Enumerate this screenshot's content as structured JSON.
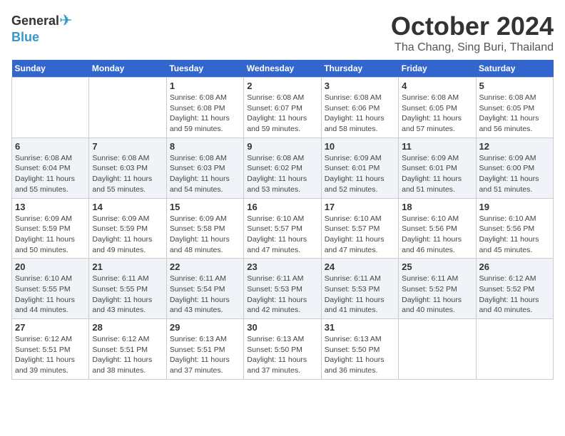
{
  "header": {
    "logo_general": "General",
    "logo_blue": "Blue",
    "month": "October 2024",
    "location": "Tha Chang, Sing Buri, Thailand"
  },
  "weekdays": [
    "Sunday",
    "Monday",
    "Tuesday",
    "Wednesday",
    "Thursday",
    "Friday",
    "Saturday"
  ],
  "weeks": [
    [
      {
        "day": "",
        "info": ""
      },
      {
        "day": "",
        "info": ""
      },
      {
        "day": "1",
        "info": "Sunrise: 6:08 AM\nSunset: 6:08 PM\nDaylight: 11 hours\nand 59 minutes."
      },
      {
        "day": "2",
        "info": "Sunrise: 6:08 AM\nSunset: 6:07 PM\nDaylight: 11 hours\nand 59 minutes."
      },
      {
        "day": "3",
        "info": "Sunrise: 6:08 AM\nSunset: 6:06 PM\nDaylight: 11 hours\nand 58 minutes."
      },
      {
        "day": "4",
        "info": "Sunrise: 6:08 AM\nSunset: 6:05 PM\nDaylight: 11 hours\nand 57 minutes."
      },
      {
        "day": "5",
        "info": "Sunrise: 6:08 AM\nSunset: 6:05 PM\nDaylight: 11 hours\nand 56 minutes."
      }
    ],
    [
      {
        "day": "6",
        "info": "Sunrise: 6:08 AM\nSunset: 6:04 PM\nDaylight: 11 hours\nand 55 minutes."
      },
      {
        "day": "7",
        "info": "Sunrise: 6:08 AM\nSunset: 6:03 PM\nDaylight: 11 hours\nand 55 minutes."
      },
      {
        "day": "8",
        "info": "Sunrise: 6:08 AM\nSunset: 6:03 PM\nDaylight: 11 hours\nand 54 minutes."
      },
      {
        "day": "9",
        "info": "Sunrise: 6:08 AM\nSunset: 6:02 PM\nDaylight: 11 hours\nand 53 minutes."
      },
      {
        "day": "10",
        "info": "Sunrise: 6:09 AM\nSunset: 6:01 PM\nDaylight: 11 hours\nand 52 minutes."
      },
      {
        "day": "11",
        "info": "Sunrise: 6:09 AM\nSunset: 6:01 PM\nDaylight: 11 hours\nand 51 minutes."
      },
      {
        "day": "12",
        "info": "Sunrise: 6:09 AM\nSunset: 6:00 PM\nDaylight: 11 hours\nand 51 minutes."
      }
    ],
    [
      {
        "day": "13",
        "info": "Sunrise: 6:09 AM\nSunset: 5:59 PM\nDaylight: 11 hours\nand 50 minutes."
      },
      {
        "day": "14",
        "info": "Sunrise: 6:09 AM\nSunset: 5:59 PM\nDaylight: 11 hours\nand 49 minutes."
      },
      {
        "day": "15",
        "info": "Sunrise: 6:09 AM\nSunset: 5:58 PM\nDaylight: 11 hours\nand 48 minutes."
      },
      {
        "day": "16",
        "info": "Sunrise: 6:10 AM\nSunset: 5:57 PM\nDaylight: 11 hours\nand 47 minutes."
      },
      {
        "day": "17",
        "info": "Sunrise: 6:10 AM\nSunset: 5:57 PM\nDaylight: 11 hours\nand 47 minutes."
      },
      {
        "day": "18",
        "info": "Sunrise: 6:10 AM\nSunset: 5:56 PM\nDaylight: 11 hours\nand 46 minutes."
      },
      {
        "day": "19",
        "info": "Sunrise: 6:10 AM\nSunset: 5:56 PM\nDaylight: 11 hours\nand 45 minutes."
      }
    ],
    [
      {
        "day": "20",
        "info": "Sunrise: 6:10 AM\nSunset: 5:55 PM\nDaylight: 11 hours\nand 44 minutes."
      },
      {
        "day": "21",
        "info": "Sunrise: 6:11 AM\nSunset: 5:55 PM\nDaylight: 11 hours\nand 43 minutes."
      },
      {
        "day": "22",
        "info": "Sunrise: 6:11 AM\nSunset: 5:54 PM\nDaylight: 11 hours\nand 43 minutes."
      },
      {
        "day": "23",
        "info": "Sunrise: 6:11 AM\nSunset: 5:53 PM\nDaylight: 11 hours\nand 42 minutes."
      },
      {
        "day": "24",
        "info": "Sunrise: 6:11 AM\nSunset: 5:53 PM\nDaylight: 11 hours\nand 41 minutes."
      },
      {
        "day": "25",
        "info": "Sunrise: 6:11 AM\nSunset: 5:52 PM\nDaylight: 11 hours\nand 40 minutes."
      },
      {
        "day": "26",
        "info": "Sunrise: 6:12 AM\nSunset: 5:52 PM\nDaylight: 11 hours\nand 40 minutes."
      }
    ],
    [
      {
        "day": "27",
        "info": "Sunrise: 6:12 AM\nSunset: 5:51 PM\nDaylight: 11 hours\nand 39 minutes."
      },
      {
        "day": "28",
        "info": "Sunrise: 6:12 AM\nSunset: 5:51 PM\nDaylight: 11 hours\nand 38 minutes."
      },
      {
        "day": "29",
        "info": "Sunrise: 6:13 AM\nSunset: 5:51 PM\nDaylight: 11 hours\nand 37 minutes."
      },
      {
        "day": "30",
        "info": "Sunrise: 6:13 AM\nSunset: 5:50 PM\nDaylight: 11 hours\nand 37 minutes."
      },
      {
        "day": "31",
        "info": "Sunrise: 6:13 AM\nSunset: 5:50 PM\nDaylight: 11 hours\nand 36 minutes."
      },
      {
        "day": "",
        "info": ""
      },
      {
        "day": "",
        "info": ""
      }
    ]
  ]
}
